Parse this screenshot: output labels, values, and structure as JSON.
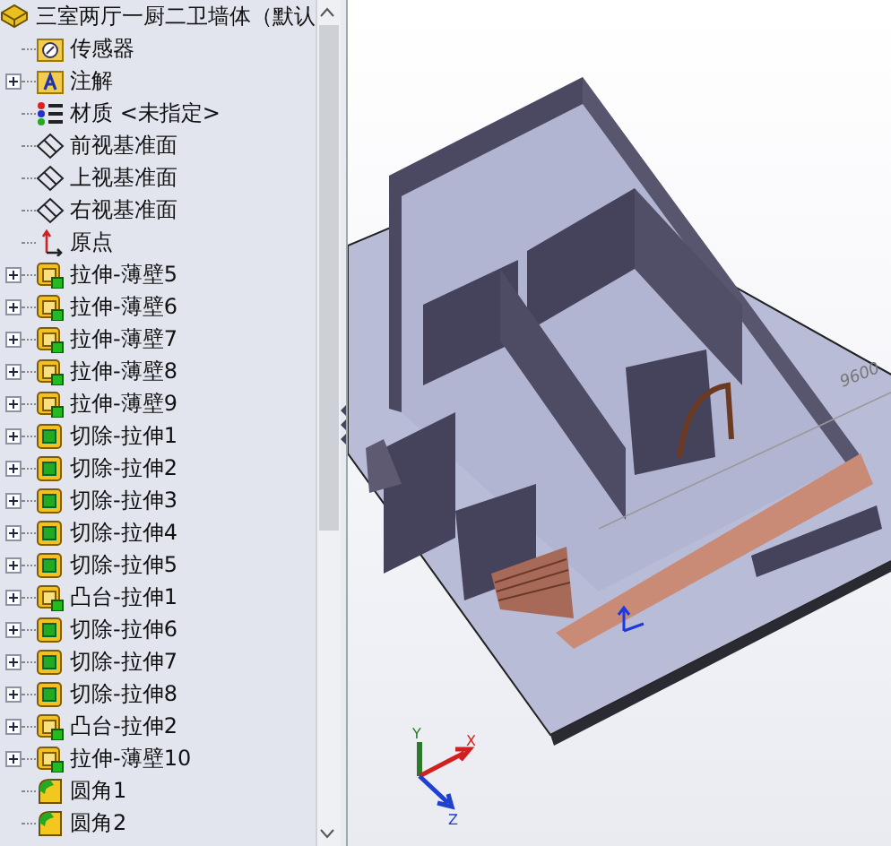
{
  "tree": {
    "root": {
      "label": "三室两厅一厨二卫墙体（默认",
      "kind": "part"
    },
    "items": [
      {
        "label": "传感器",
        "kind": "sensor",
        "expandable": false
      },
      {
        "label": "注解",
        "kind": "annotation",
        "expandable": true
      },
      {
        "label": "材质 <未指定>",
        "kind": "material",
        "expandable": false
      },
      {
        "label": "前视基准面",
        "kind": "plane",
        "expandable": false
      },
      {
        "label": "上视基准面",
        "kind": "plane",
        "expandable": false
      },
      {
        "label": "右视基准面",
        "kind": "plane",
        "expandable": false
      },
      {
        "label": "原点",
        "kind": "origin",
        "expandable": false
      },
      {
        "label": "拉伸-薄壁5",
        "kind": "boss",
        "expandable": true
      },
      {
        "label": "拉伸-薄壁6",
        "kind": "boss",
        "expandable": true
      },
      {
        "label": "拉伸-薄壁7",
        "kind": "boss",
        "expandable": true
      },
      {
        "label": "拉伸-薄壁8",
        "kind": "boss",
        "expandable": true
      },
      {
        "label": "拉伸-薄壁9",
        "kind": "boss",
        "expandable": true
      },
      {
        "label": "切除-拉伸1",
        "kind": "cut",
        "expandable": true
      },
      {
        "label": "切除-拉伸2",
        "kind": "cut",
        "expandable": true
      },
      {
        "label": "切除-拉伸3",
        "kind": "cut",
        "expandable": true
      },
      {
        "label": "切除-拉伸4",
        "kind": "cut",
        "expandable": true
      },
      {
        "label": "切除-拉伸5",
        "kind": "cut",
        "expandable": true
      },
      {
        "label": "凸台-拉伸1",
        "kind": "boss",
        "expandable": true
      },
      {
        "label": "切除-拉伸6",
        "kind": "cut",
        "expandable": true
      },
      {
        "label": "切除-拉伸7",
        "kind": "cut",
        "expandable": true
      },
      {
        "label": "切除-拉伸8",
        "kind": "cut",
        "expandable": true
      },
      {
        "label": "凸台-拉伸2",
        "kind": "boss",
        "expandable": true
      },
      {
        "label": "拉伸-薄壁10",
        "kind": "boss",
        "expandable": true
      },
      {
        "label": "圆角1",
        "kind": "fillet",
        "expandable": false
      },
      {
        "label": "圆角2",
        "kind": "fillet",
        "expandable": false
      }
    ]
  },
  "viewport": {
    "dimension": "9600",
    "axes": {
      "x": "X",
      "y": "Y",
      "z": "Z"
    }
  }
}
